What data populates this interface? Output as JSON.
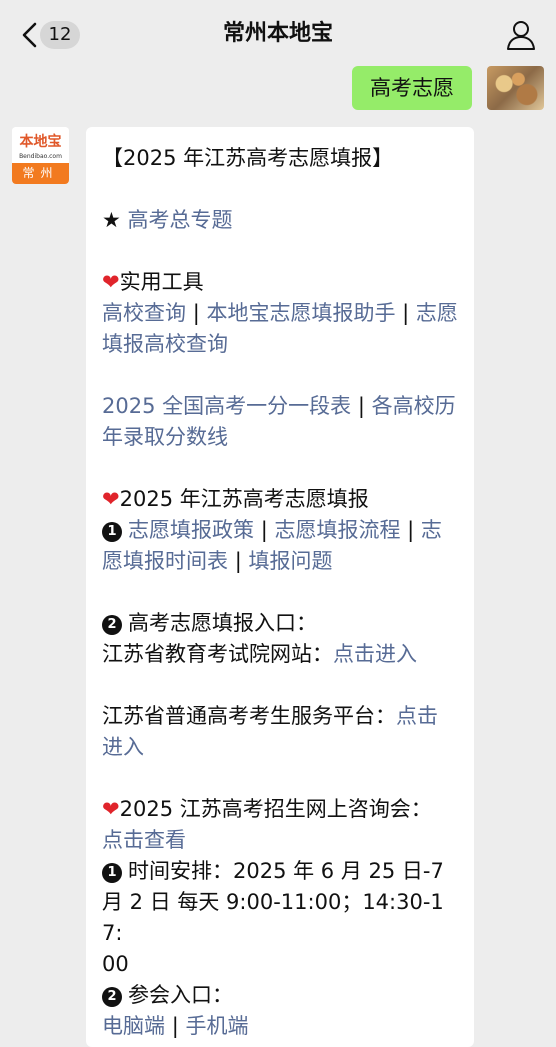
{
  "header": {
    "title": "常州本地宝",
    "unread_count": "12"
  },
  "user_message": {
    "text": "高考志愿"
  },
  "bot": {
    "brand": "本地宝",
    "url": "Bendibao.com",
    "city": "常州"
  },
  "article": {
    "heading": "【2025 年江苏高考志愿填报】",
    "star_link": "高考总专题",
    "tools_title": "实用工具",
    "tools_links": [
      "高校查询",
      "本地宝志愿填报助手",
      "志愿填报高校查询"
    ],
    "rank_links": [
      "2025 全国高考一分一段表",
      "各高校历年录取分数线"
    ],
    "section2_title": "2025 年江苏高考志愿填报",
    "policy_links": [
      "志愿填报政策",
      "志愿填报流程",
      "志愿填报时间表",
      "填报问题"
    ],
    "entry_title": "高考志愿填报入口：",
    "site1_label": "江苏省教育考试院网站：",
    "site1_link": "点击进入",
    "site2_label": "江苏省普通高考考生服务平台：",
    "site2_link_a": "点击",
    "site2_link_b": "进入",
    "consult_title": "2025 江苏高考招生网上咨询会：",
    "consult_link": "点击查看",
    "schedule_a": "时间安排：2025 年 6 月 25 日-7",
    "schedule_b": "月 2 日 每天 9:00-11:00；14:30-17:",
    "schedule_c": "00",
    "join_title": "参会入口：",
    "join_links": [
      "电脑端",
      "手机端"
    ],
    "num1": "1",
    "num2": "2"
  },
  "colors": {
    "link": "#576b95",
    "bubble": "#95ec69",
    "heart": "#e0242b"
  }
}
